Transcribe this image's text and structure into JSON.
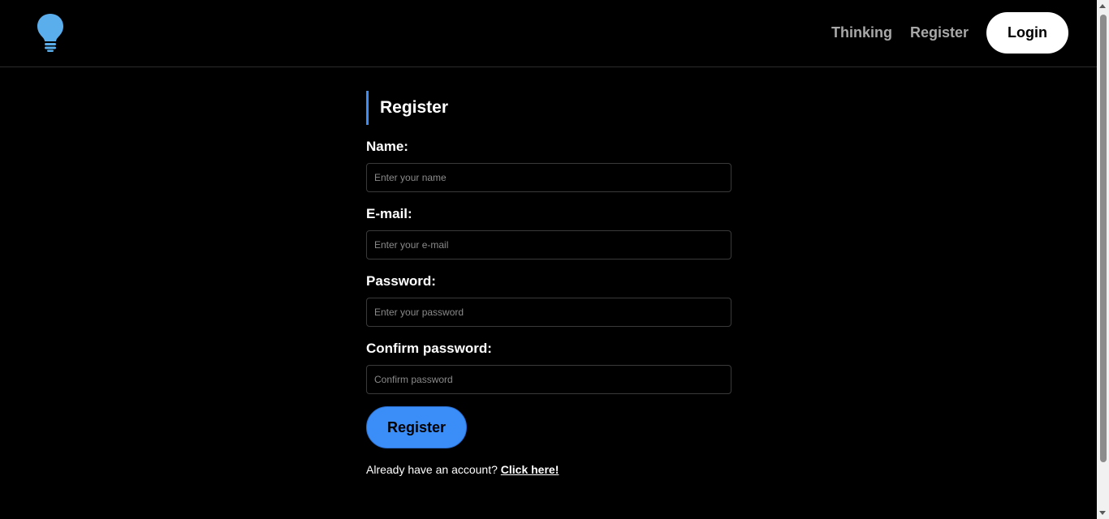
{
  "brand": {
    "icon": "lightbulb-icon",
    "color": "#5aaeec"
  },
  "nav": {
    "links": [
      {
        "label": "Thinking"
      },
      {
        "label": "Register"
      }
    ],
    "login_label": "Login"
  },
  "form": {
    "title": "Register",
    "fields": [
      {
        "label": "Name:",
        "placeholder": "Enter your name"
      },
      {
        "label": "E-mail:",
        "placeholder": "Enter your e-mail"
      },
      {
        "label": "Password:",
        "placeholder": "Enter your password"
      },
      {
        "label": "Confirm password:",
        "placeholder": "Confirm password"
      }
    ],
    "submit_label": "Register",
    "footer_text": "Already have an account?",
    "footer_link": "Click here!"
  },
  "colors": {
    "accent": "#3b8ef7",
    "background": "#000000",
    "nav_link": "#a8a8a8"
  }
}
